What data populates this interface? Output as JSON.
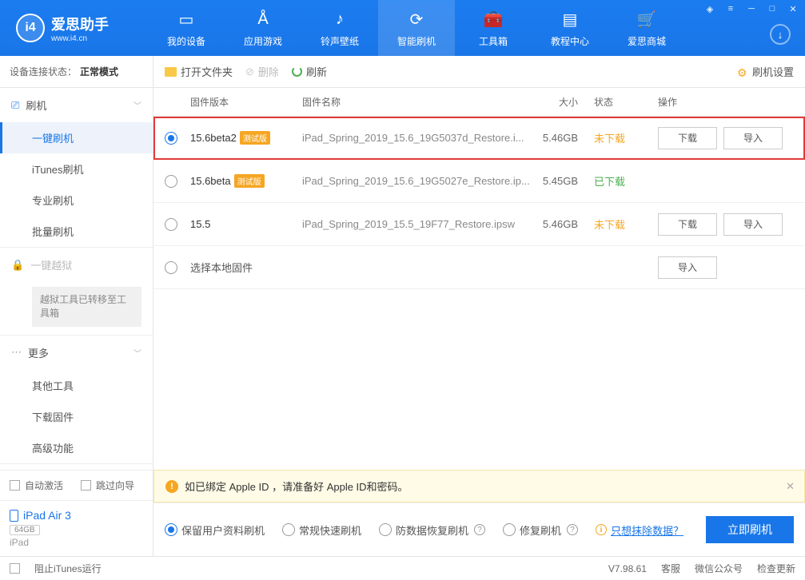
{
  "app": {
    "title": "爱思助手",
    "url": "www.i4.cn"
  },
  "nav": [
    {
      "label": "我的设备"
    },
    {
      "label": "应用游戏"
    },
    {
      "label": "铃声壁纸"
    },
    {
      "label": "智能刷机"
    },
    {
      "label": "工具箱"
    },
    {
      "label": "教程中心"
    },
    {
      "label": "爱思商城"
    }
  ],
  "conn": {
    "prefix": "设备连接状态：",
    "status": "正常模式"
  },
  "sidebar": {
    "flash": {
      "header": "刷机",
      "items": [
        "一键刷机",
        "iTunes刷机",
        "专业刷机",
        "批量刷机"
      ]
    },
    "jailbreak": {
      "header": "一键越狱",
      "note": "越狱工具已转移至工具箱"
    },
    "more": {
      "header": "更多",
      "items": [
        "其他工具",
        "下载固件",
        "高级功能"
      ]
    },
    "activation": {
      "auto": "自动激活",
      "skip": "跳过向导"
    },
    "device": {
      "name": "iPad Air 3",
      "storage": "64GB",
      "type": "iPad"
    }
  },
  "toolbar": {
    "open": "打开文件夹",
    "delete": "删除",
    "refresh": "刷新",
    "settings": "刷机设置"
  },
  "table": {
    "headers": {
      "version": "固件版本",
      "name": "固件名称",
      "size": "大小",
      "status": "状态",
      "ops": "操作"
    }
  },
  "firmware": [
    {
      "version": "15.6beta2",
      "beta": "测试版",
      "name": "iPad_Spring_2019_15.6_19G5037d_Restore.i...",
      "size": "5.46GB",
      "status": "未下载",
      "statusClass": "not",
      "selected": true,
      "ops": [
        "下载",
        "导入"
      ],
      "highlight": true
    },
    {
      "version": "15.6beta",
      "beta": "测试版",
      "name": "iPad_Spring_2019_15.6_19G5027e_Restore.ip...",
      "size": "5.45GB",
      "status": "已下载",
      "statusClass": "done",
      "selected": false,
      "ops": []
    },
    {
      "version": "15.5",
      "beta": "",
      "name": "iPad_Spring_2019_15.5_19F77_Restore.ipsw",
      "size": "5.46GB",
      "status": "未下载",
      "statusClass": "not",
      "selected": false,
      "ops": [
        "下载",
        "导入"
      ]
    },
    {
      "version": "",
      "beta": "",
      "name": "选择本地固件",
      "size": "",
      "status": "",
      "statusClass": "",
      "selected": false,
      "ops": [
        "导入"
      ],
      "local": true
    }
  ],
  "warning": "如已绑定 Apple ID ，请准备好 Apple ID和密码。",
  "flash_options": {
    "keep": "保留用户资料刷机",
    "normal": "常规快速刷机",
    "antirec": "防数据恢复刷机",
    "repair": "修复刷机",
    "erase": "只想抹除数据？",
    "go": "立即刷机"
  },
  "statusbar": {
    "block": "阻止iTunes运行",
    "version": "V7.98.61",
    "cs": "客服",
    "wechat": "微信公众号",
    "update": "检查更新"
  }
}
